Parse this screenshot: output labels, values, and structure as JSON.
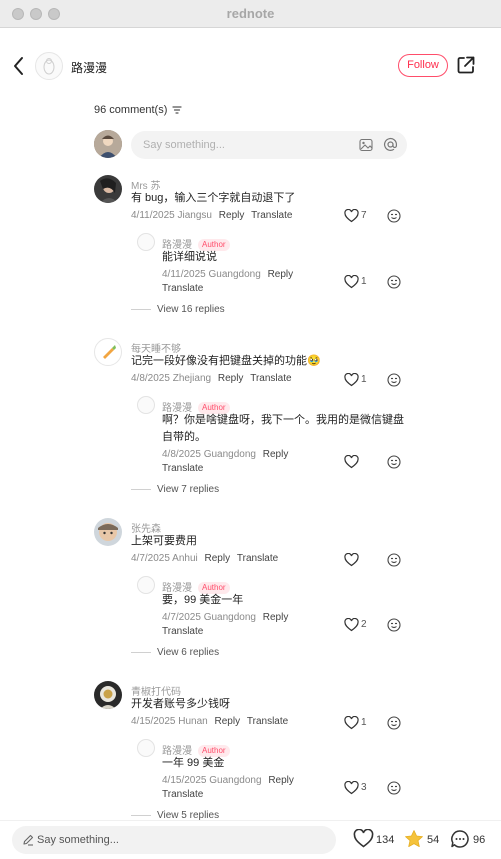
{
  "window": {
    "title": "rednote"
  },
  "header": {
    "author_name": "路漫漫",
    "follow_label": "Follow"
  },
  "comments_header": {
    "count_label": "96 comment(s)"
  },
  "top_input": {
    "placeholder": "Say something..."
  },
  "labels": {
    "reply": "Reply",
    "translate": "Translate",
    "author_badge": "Author"
  },
  "comments": [
    {
      "user": "Mrs 苏",
      "text": "有 bug，输入三个字就自动退下了",
      "date": "4/11/2025 Jiangsu",
      "likes": "7",
      "reply": {
        "user": "路漫漫",
        "text": "能详细说说",
        "date": "4/11/2025 Guangdong",
        "likes": "1"
      },
      "view_replies": "View 16 replies"
    },
    {
      "user": "每天睡不够",
      "text": "记完一段好像没有把键盘关掉的功能🥹",
      "date": "4/8/2025 Zhejiang",
      "likes": "1",
      "reply": {
        "user": "路漫漫",
        "text": "啊？你是啥键盘呀，我下一个。我用的是微信键盘",
        "text2": "自带的。",
        "date": "4/8/2025 Guangdong",
        "likes": ""
      },
      "view_replies": "View 7 replies"
    },
    {
      "user": "张先森",
      "text": "上架可要费用",
      "date": "4/7/2025 Anhui",
      "likes": "",
      "reply": {
        "user": "路漫漫",
        "text": "要，99 美金一年",
        "date": "4/7/2025 Guangdong",
        "likes": "2"
      },
      "view_replies": "View 6 replies"
    },
    {
      "user": "青椒打代码",
      "text": "开发者账号多少钱呀",
      "date": "4/15/2025 Hunan",
      "likes": "1",
      "reply": {
        "user": "路漫漫",
        "text": "一年 99 美金",
        "date": "4/15/2025 Guangdong",
        "likes": "3"
      },
      "view_replies": "View 5 replies"
    }
  ],
  "bottom_bar": {
    "placeholder": "Say something...",
    "likes": "134",
    "collects": "54",
    "comments": "96"
  },
  "colors": {
    "accent": "#ff2e4d",
    "star": "#f5c33b"
  },
  "icons": [
    "back-arrow-icon",
    "share-icon",
    "filter-icon",
    "image-icon",
    "at-icon",
    "heart-icon",
    "emoji-icon",
    "pen-icon",
    "star-icon",
    "comment-bubble-icon"
  ]
}
